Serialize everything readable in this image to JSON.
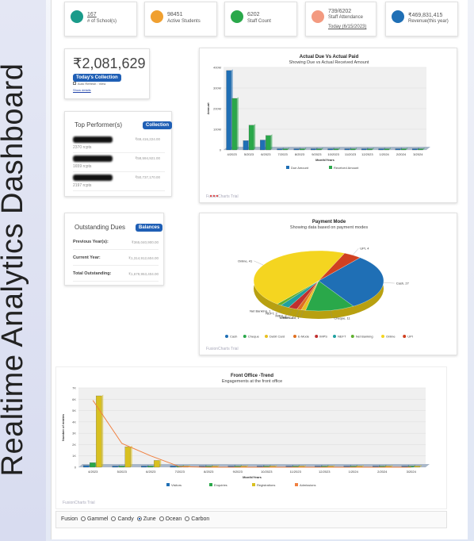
{
  "side_title": "Realtime Analytics Dashboard",
  "stats": [
    {
      "value": "167",
      "label": "# of School(s)",
      "icon": "graduation-cap-icon",
      "color": "#1a9b8a",
      "value_link": true
    },
    {
      "value": "98451",
      "label": "Active Students",
      "icon": "smile-icon",
      "color": "#f0a030"
    },
    {
      "value": "6202",
      "label": "Staff Count",
      "icon": "users-icon",
      "color": "#2aa84a"
    },
    {
      "value": "739/6202",
      "label": "Staff Attendance",
      "sub": "Today (6/15/2023)",
      "icon": "virus-icon",
      "color": "#f39a80"
    },
    {
      "value": "₹469,831,415",
      "label": "Revenue(this year)",
      "icon": "wallet-icon",
      "color": "#1f6fb5"
    }
  ],
  "collection": {
    "amount": "₹2,081,629",
    "button": "Today's Collection",
    "auto_refresh": "Auto Refresh : View",
    "details_link": "Show details"
  },
  "top_performers": {
    "title": "Top Performer(s)",
    "button": "Collection",
    "rows": [
      {
        "amount": "₹69,416,224.00",
        "sub": "2370 rcpts"
      },
      {
        "amount": "₹58,594,921.00",
        "sub": "1659 rcpts"
      },
      {
        "amount": "₹50,737,170.00",
        "sub": "2197 rcpts"
      }
    ]
  },
  "outstanding": {
    "title": "Outstanding Dues",
    "button": "Balances",
    "rows": [
      {
        "label": "Previous Year(s):",
        "value": "₹365,040,900.00"
      },
      {
        "label": "Current Year:",
        "value": "₹1,314,912,604.00"
      },
      {
        "label": "Total Outstanding:",
        "value": "₹1,679,953,404.00"
      }
    ]
  },
  "watermark": "FusionCharts Trial",
  "chart_data": [
    {
      "type": "bar",
      "title": "Actual Due Vs Actual Paid",
      "subtitle": "Showing Due vs Actual Received Amount",
      "xlabel": "Month/Years",
      "ylabel": "Amount",
      "categories": [
        "4/2023",
        "5/2023",
        "6/2023",
        "7/2023",
        "8/2023",
        "9/2023",
        "10/2023",
        "11/2023",
        "12/2023",
        "1/2024",
        "2/2024",
        "3/2024"
      ],
      "yticks": [
        "0",
        "100M",
        "200M",
        "300M",
        "400M"
      ],
      "ylim": [
        0,
        400
      ],
      "series": [
        {
          "name": "Due Amount",
          "color": "#1f6fb5",
          "values": [
            385,
            45,
            48,
            2,
            2,
            2,
            2,
            2,
            2,
            2,
            2,
            2
          ]
        },
        {
          "name": "Received Amount",
          "color": "#2aa84a",
          "values": [
            250,
            120,
            70,
            0,
            0,
            0,
            0,
            0,
            0,
            0,
            0,
            0
          ]
        }
      ]
    },
    {
      "type": "pie",
      "title": "Payment Mode",
      "subtitle": "Showing data based on payment modes",
      "slices": [
        {
          "name": "Cash",
          "label": "Cash, 27",
          "value": 27,
          "color": "#1f6fb5"
        },
        {
          "name": "Cheque",
          "label": "Cheque, 11",
          "value": 11,
          "color": "#2aa84a"
        },
        {
          "name": "Debit Card",
          "label": "Debit Card, 1",
          "value": 1,
          "color": "#e8c020"
        },
        {
          "name": "E-Mode",
          "label": "E-Mode, 1",
          "value": 1,
          "color": "#e07020"
        },
        {
          "name": "IMPS",
          "label": "IMPS, 2",
          "value": 2,
          "color": "#c03030"
        },
        {
          "name": "NEFT",
          "label": "NEFT, 2",
          "value": 2,
          "color": "#20a0a0"
        },
        {
          "name": "Net Banking",
          "label": "Net Banking, 1",
          "value": 1,
          "color": "#60b030"
        },
        {
          "name": "Online",
          "label": "Online, 41",
          "value": 41,
          "color": "#f4d520"
        },
        {
          "name": "UPI",
          "label": "UPI, 4",
          "value": 4,
          "color": "#d04020"
        }
      ]
    },
    {
      "type": "bar",
      "title": "Front Office -Trend",
      "subtitle": "Engagements at the front office",
      "xlabel": "Month/Years",
      "ylabel": "Number of entries",
      "categories": [
        "4/2023",
        "5/2023",
        "6/2023",
        "7/2023",
        "8/2023",
        "9/2023",
        "10/2023",
        "11/2023",
        "12/2023",
        "1/2024",
        "2/2024",
        "3/2024"
      ],
      "yticks": [
        "0",
        "1K",
        "2K",
        "3K",
        "4K",
        "5K",
        "6K",
        "7K"
      ],
      "ylim": [
        0,
        7
      ],
      "series": [
        {
          "name": "Visitors",
          "color": "#1f6fb5",
          "values": [
            0.15,
            0.05,
            0.05,
            0,
            0,
            0,
            0,
            0,
            0,
            0,
            0,
            0
          ]
        },
        {
          "name": "Enquiries",
          "color": "#2aa84a",
          "values": [
            0.4,
            0.1,
            0.05,
            0,
            0,
            0,
            0,
            0,
            0,
            0,
            0,
            0
          ]
        },
        {
          "name": "Registrations",
          "color": "#d8c020",
          "values": [
            6.3,
            1.8,
            0.6,
            0.05,
            0,
            0,
            0,
            0,
            0,
            0,
            0,
            0
          ]
        },
        {
          "name": "Admissions",
          "color": "#f08040",
          "line": true,
          "values": [
            5.9,
            2.1,
            1.0,
            0.05,
            0,
            0,
            0,
            0,
            0,
            0,
            0,
            0
          ]
        }
      ]
    }
  ],
  "themes": {
    "options": [
      "Fusion",
      "Gammel",
      "Candy",
      "Zune",
      "Ocean",
      "Carbon"
    ],
    "selected": "Zune"
  }
}
